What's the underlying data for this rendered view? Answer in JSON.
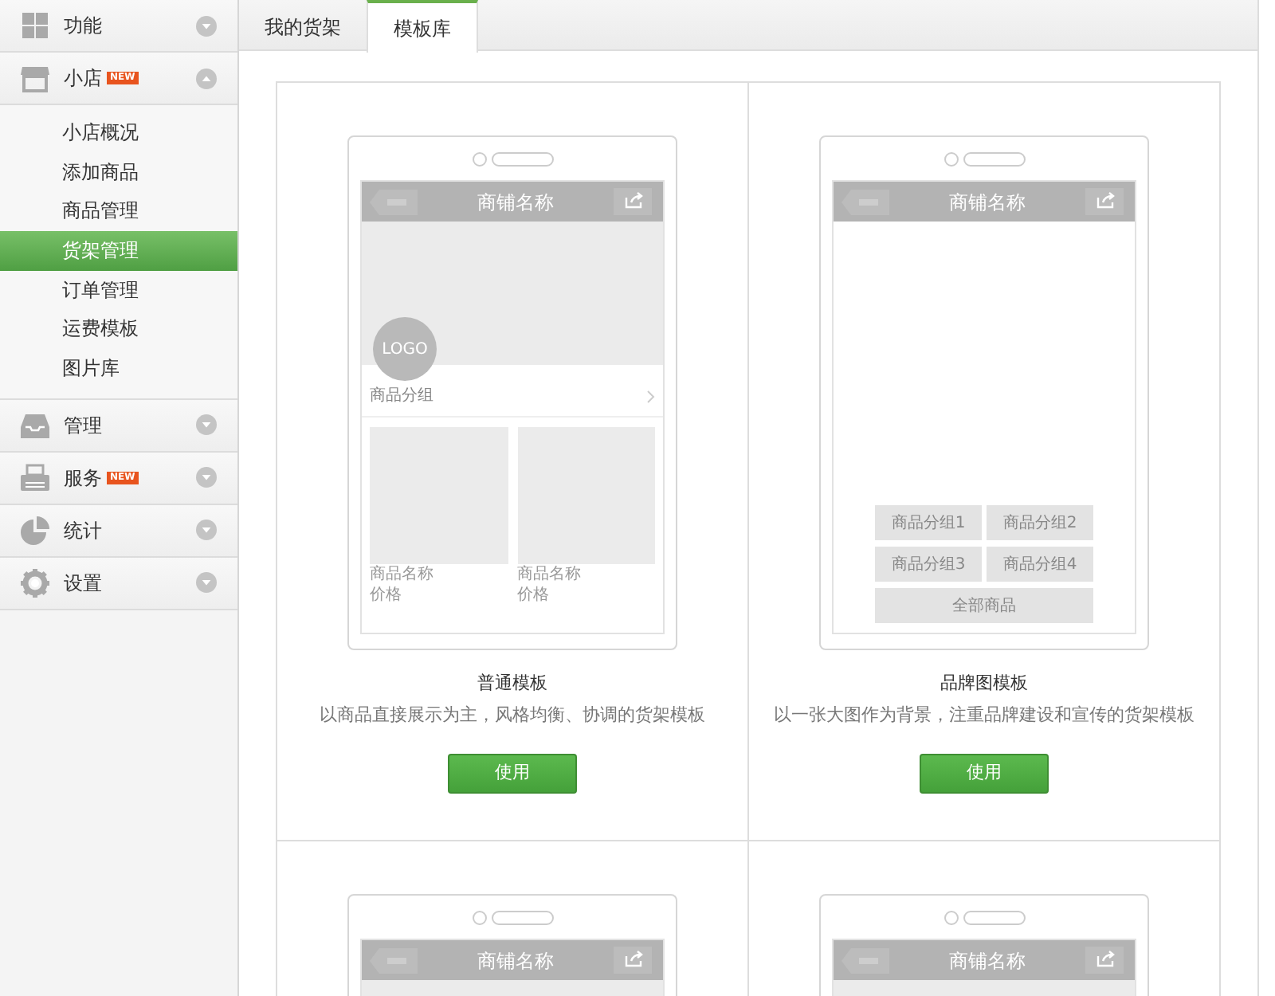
{
  "sidebar": {
    "sections": [
      {
        "label": "功能",
        "expanded": false
      },
      {
        "label": "小店",
        "badge": "NEW",
        "expanded": true,
        "items": [
          {
            "label": "小店概况",
            "selected": false
          },
          {
            "label": "添加商品",
            "selected": false
          },
          {
            "label": "商品管理",
            "selected": false
          },
          {
            "label": "货架管理",
            "selected": true
          },
          {
            "label": "订单管理",
            "selected": false
          },
          {
            "label": "运费模板",
            "selected": false
          },
          {
            "label": "图片库",
            "selected": false
          }
        ]
      },
      {
        "label": "管理",
        "expanded": false
      },
      {
        "label": "服务",
        "badge": "NEW",
        "expanded": false
      },
      {
        "label": "统计",
        "expanded": false
      },
      {
        "label": "设置",
        "expanded": false
      }
    ]
  },
  "tabs": [
    {
      "label": "我的货架",
      "selected": false
    },
    {
      "label": "模板库",
      "selected": true
    }
  ],
  "templates": [
    {
      "kind": "standard",
      "store_name": "商铺名称",
      "logo": "LOGO",
      "group_label": "商品分组",
      "products": [
        {
          "name": "商品名称",
          "price": "价格"
        },
        {
          "name": "商品名称",
          "price": "价格"
        }
      ],
      "name": "普通模板",
      "description": "以商品直接展示为主，风格均衡、协调的货架模板",
      "button": "使用"
    },
    {
      "kind": "brand",
      "store_name": "商铺名称",
      "groups": [
        "商品分组1",
        "商品分组2",
        "商品分组3",
        "商品分组4"
      ],
      "all_label": "全部商品",
      "name": "品牌图模板",
      "description": "以一张大图作为背景，注重品牌建设和宣传的货架模板",
      "button": "使用"
    },
    {
      "kind": "partial",
      "store_name": "商铺名称"
    },
    {
      "kind": "partial",
      "store_name": "商铺名称"
    }
  ]
}
